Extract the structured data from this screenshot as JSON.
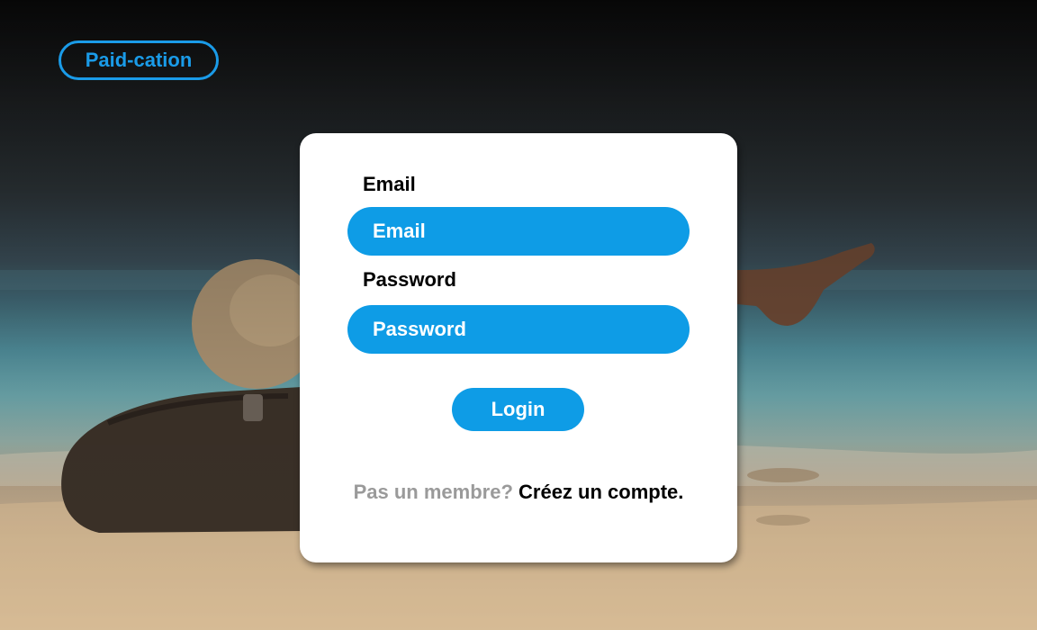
{
  "brand": {
    "name": "Paid-cation",
    "color": "#1a9be8"
  },
  "login_form": {
    "email_label": "Email",
    "email_placeholder": "Email",
    "email_value": "",
    "password_label": "Password",
    "password_placeholder": "Password",
    "password_value": "",
    "submit_label": "Login",
    "accent_color": "#0e9ce6"
  },
  "signup": {
    "prompt": "Pas un membre?",
    "link_label": "Créez un compte."
  },
  "background": {
    "scene": "beach-photo"
  }
}
